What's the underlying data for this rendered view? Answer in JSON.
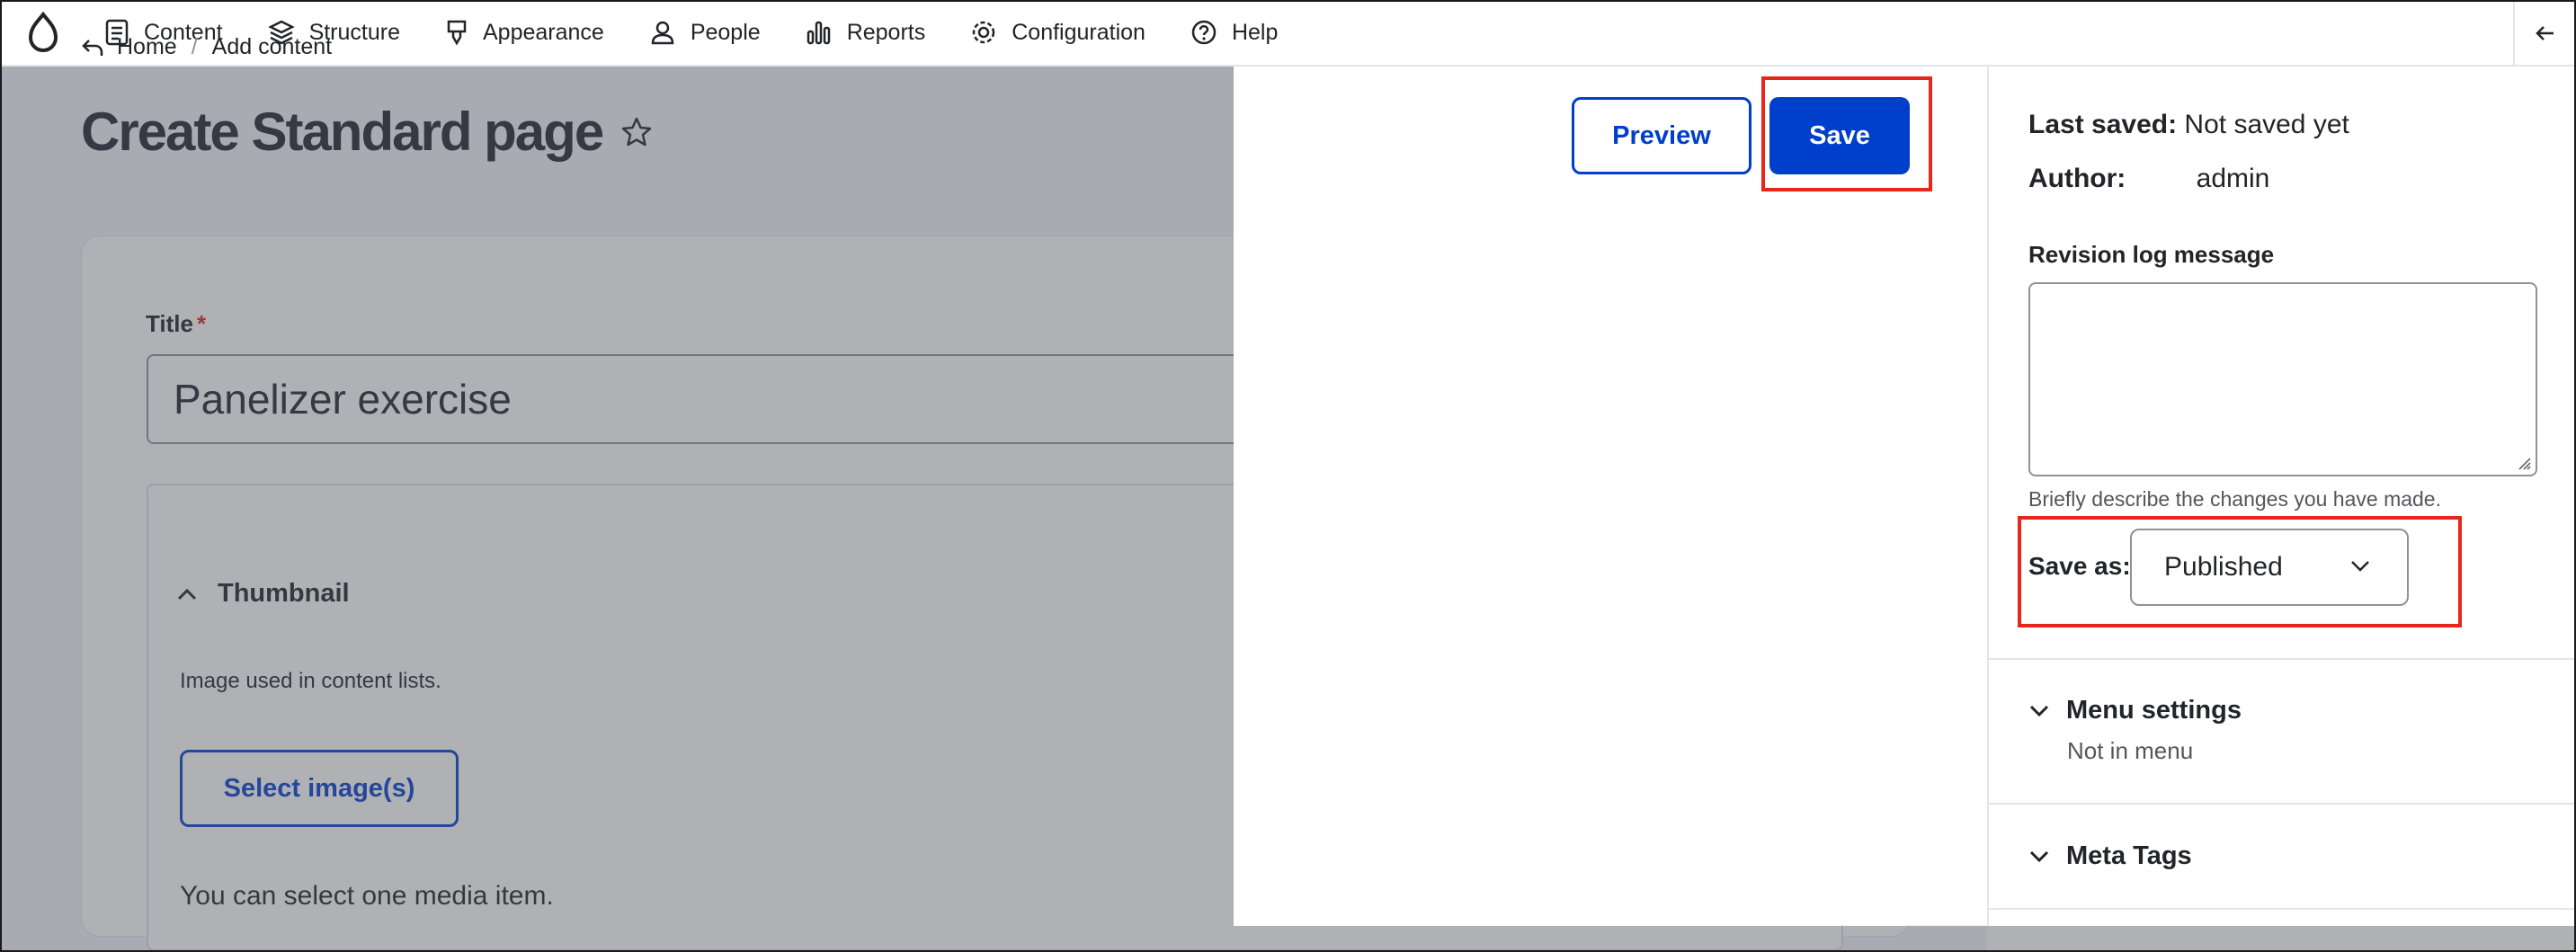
{
  "toolbar": {
    "items": [
      {
        "label": "Content",
        "icon": "content-icon"
      },
      {
        "label": "Structure",
        "icon": "structure-icon"
      },
      {
        "label": "Appearance",
        "icon": "appearance-icon"
      },
      {
        "label": "People",
        "icon": "people-icon"
      },
      {
        "label": "Reports",
        "icon": "reports-icon"
      },
      {
        "label": "Configuration",
        "icon": "gear-icon"
      },
      {
        "label": "Help",
        "icon": "help-icon"
      }
    ]
  },
  "breadcrumb": {
    "home": "Home",
    "separator": "/",
    "current": "Add content"
  },
  "page": {
    "title": "Create Standard page",
    "preview_label": "Preview",
    "save_label": "Save"
  },
  "form": {
    "title_label": "Title",
    "required_mark": "*",
    "title_value": "Panelizer exercise",
    "thumbnail": {
      "summary": "Thumbnail",
      "description": "Image used in content lists.",
      "select_label": "Select image(s)",
      "note": "You can select one media item."
    }
  },
  "sidebar": {
    "last_saved_label": "Last saved:",
    "last_saved_value": "Not saved yet",
    "author_label": "Author:",
    "author_value": "admin",
    "revision_label": "Revision log message",
    "revision_value": "",
    "revision_help": "Briefly describe the changes you have made.",
    "save_as_label": "Save as:",
    "save_as_value": "Published",
    "menu_settings_label": "Menu settings",
    "menu_settings_sub": "Not in menu",
    "meta_tags_label": "Meta Tags"
  },
  "colors": {
    "primary": "#003ecc",
    "highlight": "#e8261c",
    "required": "#dc2323"
  }
}
